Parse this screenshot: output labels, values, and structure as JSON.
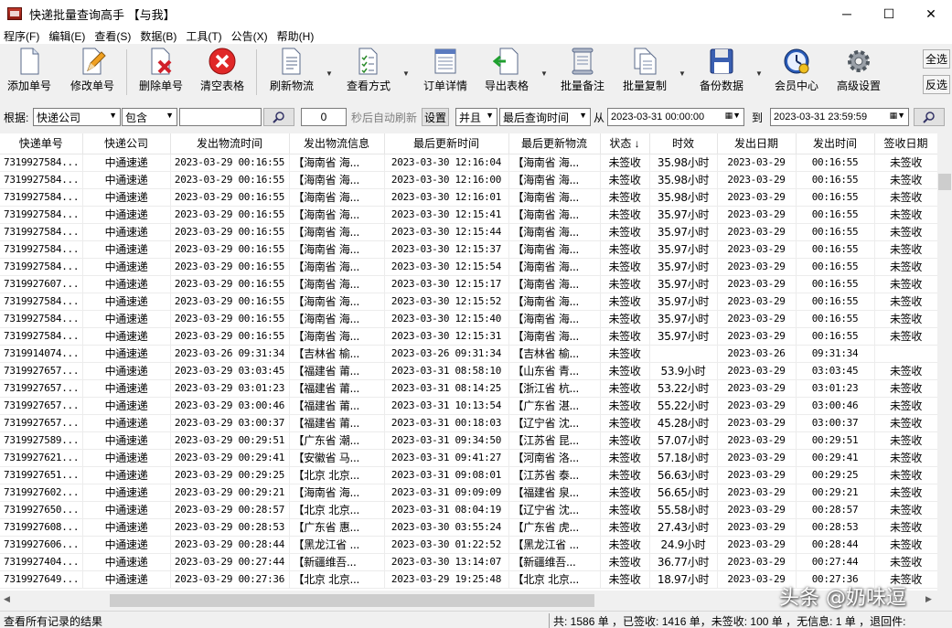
{
  "window": {
    "title": "快递批量查询高手 【与我】",
    "minimize": "─",
    "maximize": "☐",
    "close": "✕"
  },
  "menu": [
    "程序(F)",
    "编辑(E)",
    "查看(S)",
    "数据(B)",
    "工具(T)",
    "公告(X)",
    "帮助(H)"
  ],
  "toolbar": {
    "add": "添加单号",
    "modify": "修改单号",
    "delete": "删除单号",
    "clear": "清空表格",
    "refresh": "刷新物流",
    "view": "查看方式",
    "detail": "订单详情",
    "export": "导出表格",
    "batch_note": "批量备注",
    "batch_copy": "批量复制",
    "backup": "备份数据",
    "member": "会员中心",
    "settings": "高级设置",
    "select_all": "全选",
    "invert": "反选"
  },
  "filter": {
    "by_label": "根据:",
    "field": "快递公司",
    "operator": "包含",
    "keyword": "",
    "seconds": "0",
    "auto_refresh_label": "秒后自动刷新",
    "set": "设置",
    "logic": "并且",
    "time_field": "最后查询时间",
    "from_label": "从",
    "from": "2023-03-31 00:00:00",
    "to_label": "到",
    "to": "2023-03-31 23:59:59"
  },
  "columns": [
    "快递单号",
    "快递公司",
    "发出物流时间",
    "发出物流信息",
    "最后更新时间",
    "最后更新物流",
    "状态",
    "时效",
    "发出日期",
    "发出时间",
    "签收日期"
  ],
  "sort_indicator": "↓",
  "rows": [
    [
      "7319927584...",
      "中通速递",
      "2023-03-29 00:16:55",
      "【海南省 海...",
      "2023-03-30 12:16:04",
      "【海南省 海...",
      "未签收",
      "35.98小时",
      "2023-03-29",
      "00:16:55",
      "未签收"
    ],
    [
      "7319927584...",
      "中通速递",
      "2023-03-29 00:16:55",
      "【海南省 海...",
      "2023-03-30 12:16:00",
      "【海南省 海...",
      "未签收",
      "35.98小时",
      "2023-03-29",
      "00:16:55",
      "未签收"
    ],
    [
      "7319927584...",
      "中通速递",
      "2023-03-29 00:16:55",
      "【海南省 海...",
      "2023-03-30 12:16:01",
      "【海南省 海...",
      "未签收",
      "35.98小时",
      "2023-03-29",
      "00:16:55",
      "未签收"
    ],
    [
      "7319927584...",
      "中通速递",
      "2023-03-29 00:16:55",
      "【海南省 海...",
      "2023-03-30 12:15:41",
      "【海南省 海...",
      "未签收",
      "35.97小时",
      "2023-03-29",
      "00:16:55",
      "未签收"
    ],
    [
      "7319927584...",
      "中通速递",
      "2023-03-29 00:16:55",
      "【海南省 海...",
      "2023-03-30 12:15:44",
      "【海南省 海...",
      "未签收",
      "35.97小时",
      "2023-03-29",
      "00:16:55",
      "未签收"
    ],
    [
      "7319927584...",
      "中通速递",
      "2023-03-29 00:16:55",
      "【海南省 海...",
      "2023-03-30 12:15:37",
      "【海南省 海...",
      "未签收",
      "35.97小时",
      "2023-03-29",
      "00:16:55",
      "未签收"
    ],
    [
      "7319927584...",
      "中通速递",
      "2023-03-29 00:16:55",
      "【海南省 海...",
      "2023-03-30 12:15:54",
      "【海南省 海...",
      "未签收",
      "35.97小时",
      "2023-03-29",
      "00:16:55",
      "未签收"
    ],
    [
      "7319927607...",
      "中通速递",
      "2023-03-29 00:16:55",
      "【海南省 海...",
      "2023-03-30 12:15:17",
      "【海南省 海...",
      "未签收",
      "35.97小时",
      "2023-03-29",
      "00:16:55",
      "未签收"
    ],
    [
      "7319927584...",
      "中通速递",
      "2023-03-29 00:16:55",
      "【海南省 海...",
      "2023-03-30 12:15:52",
      "【海南省 海...",
      "未签收",
      "35.97小时",
      "2023-03-29",
      "00:16:55",
      "未签收"
    ],
    [
      "7319927584...",
      "中通速递",
      "2023-03-29 00:16:55",
      "【海南省 海...",
      "2023-03-30 12:15:40",
      "【海南省 海...",
      "未签收",
      "35.97小时",
      "2023-03-29",
      "00:16:55",
      "未签收"
    ],
    [
      "7319927584...",
      "中通速递",
      "2023-03-29 00:16:55",
      "【海南省 海...",
      "2023-03-30 12:15:31",
      "【海南省 海...",
      "未签收",
      "35.97小时",
      "2023-03-29",
      "00:16:55",
      "未签收"
    ],
    [
      "7319914074...",
      "中通速递",
      "2023-03-26 09:31:34",
      "【吉林省 榆...",
      "2023-03-26 09:31:34",
      "【吉林省 榆...",
      "未签收",
      "",
      "2023-03-26",
      "09:31:34",
      ""
    ],
    [
      "7319927657...",
      "中通速递",
      "2023-03-29 03:03:45",
      "【福建省 莆...",
      "2023-03-31 08:58:10",
      "【山东省 青...",
      "未签收",
      "53.9小时",
      "2023-03-29",
      "03:03:45",
      "未签收"
    ],
    [
      "7319927657...",
      "中通速递",
      "2023-03-29 03:01:23",
      "【福建省 莆...",
      "2023-03-31 08:14:25",
      "【浙江省 杭...",
      "未签收",
      "53.22小时",
      "2023-03-29",
      "03:01:23",
      "未签收"
    ],
    [
      "7319927657...",
      "中通速递",
      "2023-03-29 03:00:46",
      "【福建省 莆...",
      "2023-03-31 10:13:54",
      "【广东省 湛...",
      "未签收",
      "55.22小时",
      "2023-03-29",
      "03:00:46",
      "未签收"
    ],
    [
      "7319927657...",
      "中通速递",
      "2023-03-29 03:00:37",
      "【福建省 莆...",
      "2023-03-31 00:18:03",
      "【辽宁省 沈...",
      "未签收",
      "45.28小时",
      "2023-03-29",
      "03:00:37",
      "未签收"
    ],
    [
      "7319927589...",
      "中通速递",
      "2023-03-29 00:29:51",
      "【广东省 潮...",
      "2023-03-31 09:34:50",
      "【江苏省 昆...",
      "未签收",
      "57.07小时",
      "2023-03-29",
      "00:29:51",
      "未签收"
    ],
    [
      "7319927621...",
      "中通速递",
      "2023-03-29 00:29:41",
      "【安徽省 马...",
      "2023-03-31 09:41:27",
      "【河南省 洛...",
      "未签收",
      "57.18小时",
      "2023-03-29",
      "00:29:41",
      "未签收"
    ],
    [
      "7319927651...",
      "中通速递",
      "2023-03-29 00:29:25",
      "【北京 北京...",
      "2023-03-31 09:08:01",
      "【江苏省 泰...",
      "未签收",
      "56.63小时",
      "2023-03-29",
      "00:29:25",
      "未签收"
    ],
    [
      "7319927602...",
      "中通速递",
      "2023-03-29 00:29:21",
      "【海南省 海...",
      "2023-03-31 09:09:09",
      "【福建省 泉...",
      "未签收",
      "56.65小时",
      "2023-03-29",
      "00:29:21",
      "未签收"
    ],
    [
      "7319927650...",
      "中通速递",
      "2023-03-29 00:28:57",
      "【北京 北京...",
      "2023-03-31 08:04:19",
      "【辽宁省 沈...",
      "未签收",
      "55.58小时",
      "2023-03-29",
      "00:28:57",
      "未签收"
    ],
    [
      "7319927608...",
      "中通速递",
      "2023-03-29 00:28:53",
      "【广东省 惠...",
      "2023-03-30 03:55:24",
      "【广东省 虎...",
      "未签收",
      "27.43小时",
      "2023-03-29",
      "00:28:53",
      "未签收"
    ],
    [
      "7319927606...",
      "中通速递",
      "2023-03-29 00:28:44",
      "【黑龙江省 ...",
      "2023-03-30 01:22:52",
      "【黑龙江省 ...",
      "未签收",
      "24.9小时",
      "2023-03-29",
      "00:28:44",
      "未签收"
    ],
    [
      "7319927404...",
      "中通速递",
      "2023-03-29 00:27:44",
      "【新疆维吾...",
      "2023-03-30 13:14:07",
      "【新疆维吾...",
      "未签收",
      "36.77小时",
      "2023-03-29",
      "00:27:44",
      "未签收"
    ],
    [
      "7319927649...",
      "中通速递",
      "2023-03-29 00:27:36",
      "【北京 北京...",
      "2023-03-29 19:25:48",
      "【北京 北京...",
      "未签收",
      "18.97小时",
      "2023-03-29",
      "00:27:36",
      "未签收"
    ]
  ],
  "status": {
    "left": "查看所有记录的结果",
    "right": "共: 1586 单 ，已签收: 1416 单，未签收: 100 单 ，无信息: 1 单 ，退回件:"
  },
  "watermark": "头条 @奶味逗"
}
